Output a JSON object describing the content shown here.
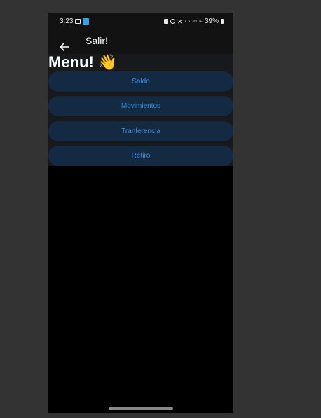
{
  "status_bar": {
    "time": "3:23",
    "battery": "39%",
    "network": "VoLTE"
  },
  "app_bar": {
    "title": "Salir!"
  },
  "main": {
    "heading": "Menu! 👋",
    "menu_items": [
      {
        "label": "Saldo"
      },
      {
        "label": "Movimientos"
      },
      {
        "label": "Tranferencia"
      },
      {
        "label": "Retiro"
      }
    ]
  },
  "colors": {
    "button_bg": "#132a42",
    "button_text": "#3d8fe0",
    "app_bar_bg": "#121212",
    "page_bg": "#000000",
    "outer_bg": "#333333"
  },
  "icons": [
    "back-arrow-icon",
    "chat-icon",
    "app-notification-icon",
    "nfc-icon",
    "alarm-icon",
    "mute-icon",
    "wifi-icon",
    "signal-icon",
    "battery-icon"
  ]
}
